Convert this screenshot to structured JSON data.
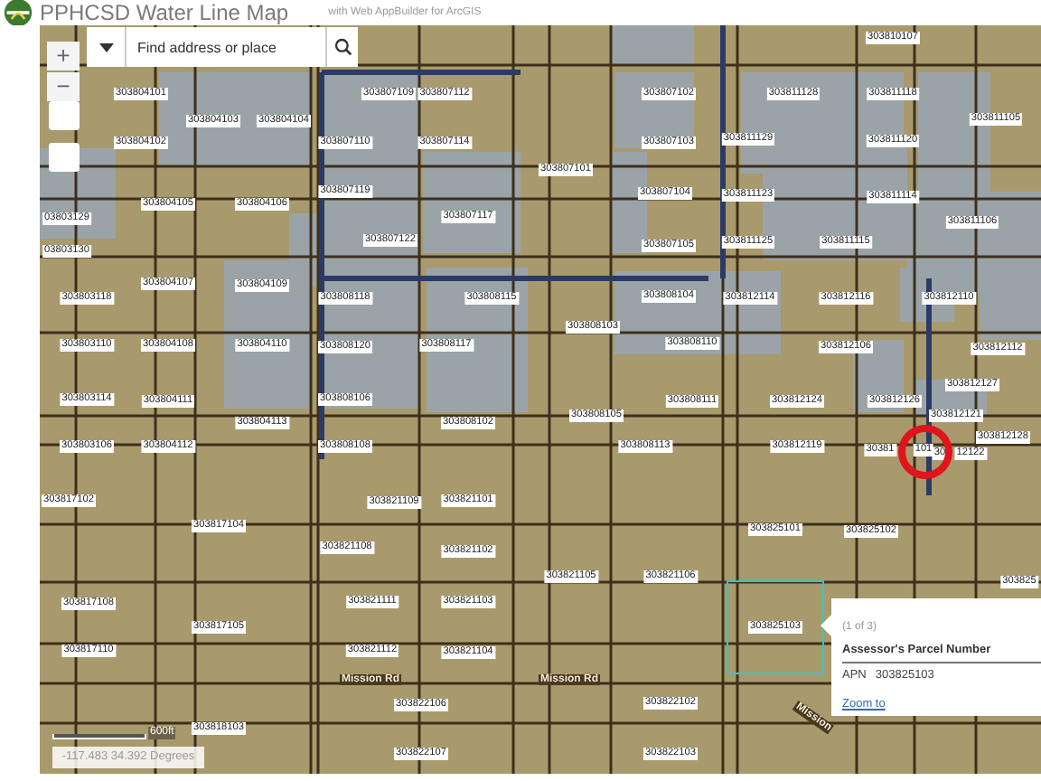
{
  "header": {
    "title": "PPHCSD Water Line Map",
    "subtitle": "with Web AppBuilder for ArcGIS"
  },
  "search": {
    "placeholder": "Find address or place"
  },
  "zoom_buttons": [
    "+",
    "−"
  ],
  "parcel_labels": [
    "303804101",
    "303807109",
    "303807112",
    "303810107",
    "303807102",
    "303811128",
    "303811118",
    "303804103",
    "303804104",
    "303811105",
    "303804102",
    "303807110",
    "303807114",
    "303807103",
    "303811129",
    "303811120",
    "303807101",
    "303807119",
    "303807104",
    "303811123",
    "303811114",
    "303804105",
    "303804106",
    "303807117",
    "03803129",
    "303811106",
    "303807122",
    "303807105",
    "303811125",
    "303811115",
    "03803130",
    "303803118",
    "303804107",
    "303804109",
    "303808118",
    "303808115",
    "303803110",
    "303804108",
    "303804110",
    "303808120",
    "303808117",
    "303803114",
    "303804111",
    "303804113",
    "303808106",
    "303808102",
    "303803106",
    "303804112",
    "303808108",
    "303817102",
    "303821109",
    "303821101",
    "303808104",
    "303812114",
    "303812116",
    "303812110",
    "303808103",
    "303808110",
    "303812106",
    "303812112",
    "303812127",
    "303808111",
    "303812124",
    "303812126",
    "303808105",
    "303812121",
    "303812128",
    "303808113",
    "303812119",
    "30381",
    "101",
    "30",
    "12122",
    "303817104",
    "303821108",
    "303821102",
    "303817108",
    "303821111",
    "303821103",
    "303817105",
    "303817110",
    "303821112",
    "303821104",
    "303822106",
    "303818103",
    "303822107",
    "303825101",
    "303825102",
    "303821105",
    "303821106",
    "303825",
    "303825103",
    "303822102",
    "303822103"
  ],
  "road_labels": [
    "Mission Rd",
    "Mission Rd",
    "Mission"
  ],
  "popup": {
    "counter": "(1 of 3)",
    "title": "Assessor's Parcel Number",
    "field": "APN",
    "value": "303825103",
    "link": "Zoom to"
  },
  "scale_bar": {
    "label": "600ft"
  },
  "coordinates": "-117.483 34.392 Degrees"
}
